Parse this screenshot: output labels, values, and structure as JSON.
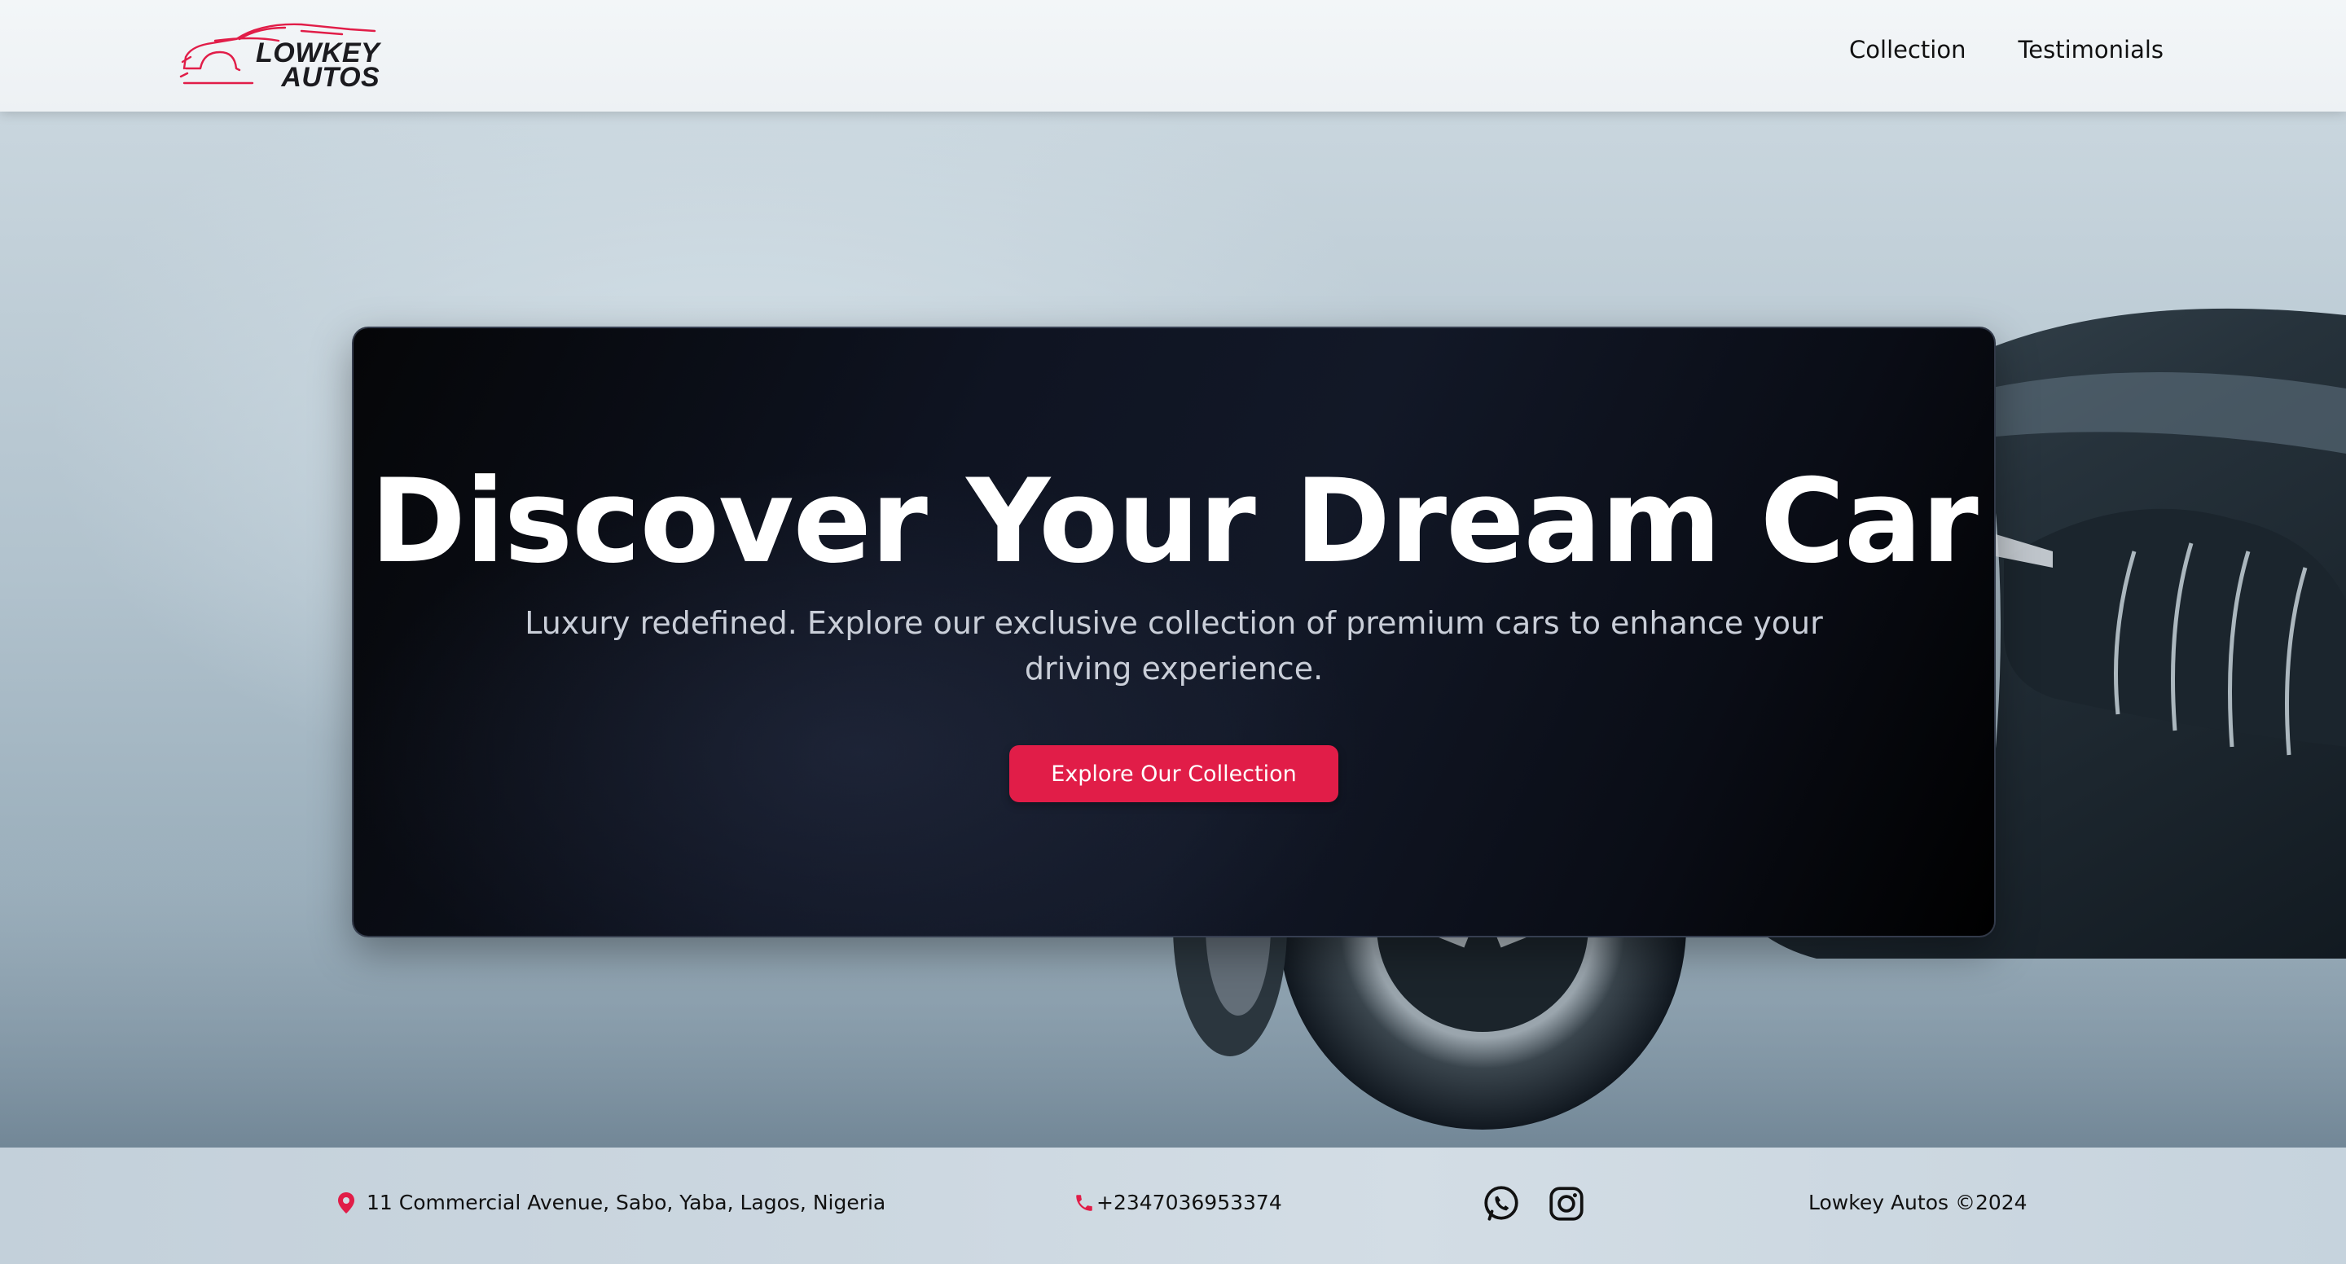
{
  "brand": {
    "name_line1": "LOWKEY",
    "name_line2": "AUTOS",
    "accent_color": "#e11d48"
  },
  "nav": {
    "links": [
      {
        "label": "Collection"
      },
      {
        "label": "Testimonials"
      }
    ]
  },
  "hero": {
    "title": "Discover Your Dream Car",
    "subtitle": "Luxury redefined. Explore our exclusive collection of premium cars to enhance your driving experience.",
    "cta_label": "Explore Our Collection",
    "cta_color": "#e11d48"
  },
  "footer": {
    "address": "11 Commercial Avenue, Sabo, Yaba, Lagos, Nigeria",
    "address_icon": "map-pin-icon",
    "phone": "+2347036953374",
    "phone_icon": "phone-icon",
    "social": [
      {
        "icon": "whatsapp-icon"
      },
      {
        "icon": "instagram-icon"
      }
    ],
    "copyright": "Lowkey Autos ©2024"
  }
}
